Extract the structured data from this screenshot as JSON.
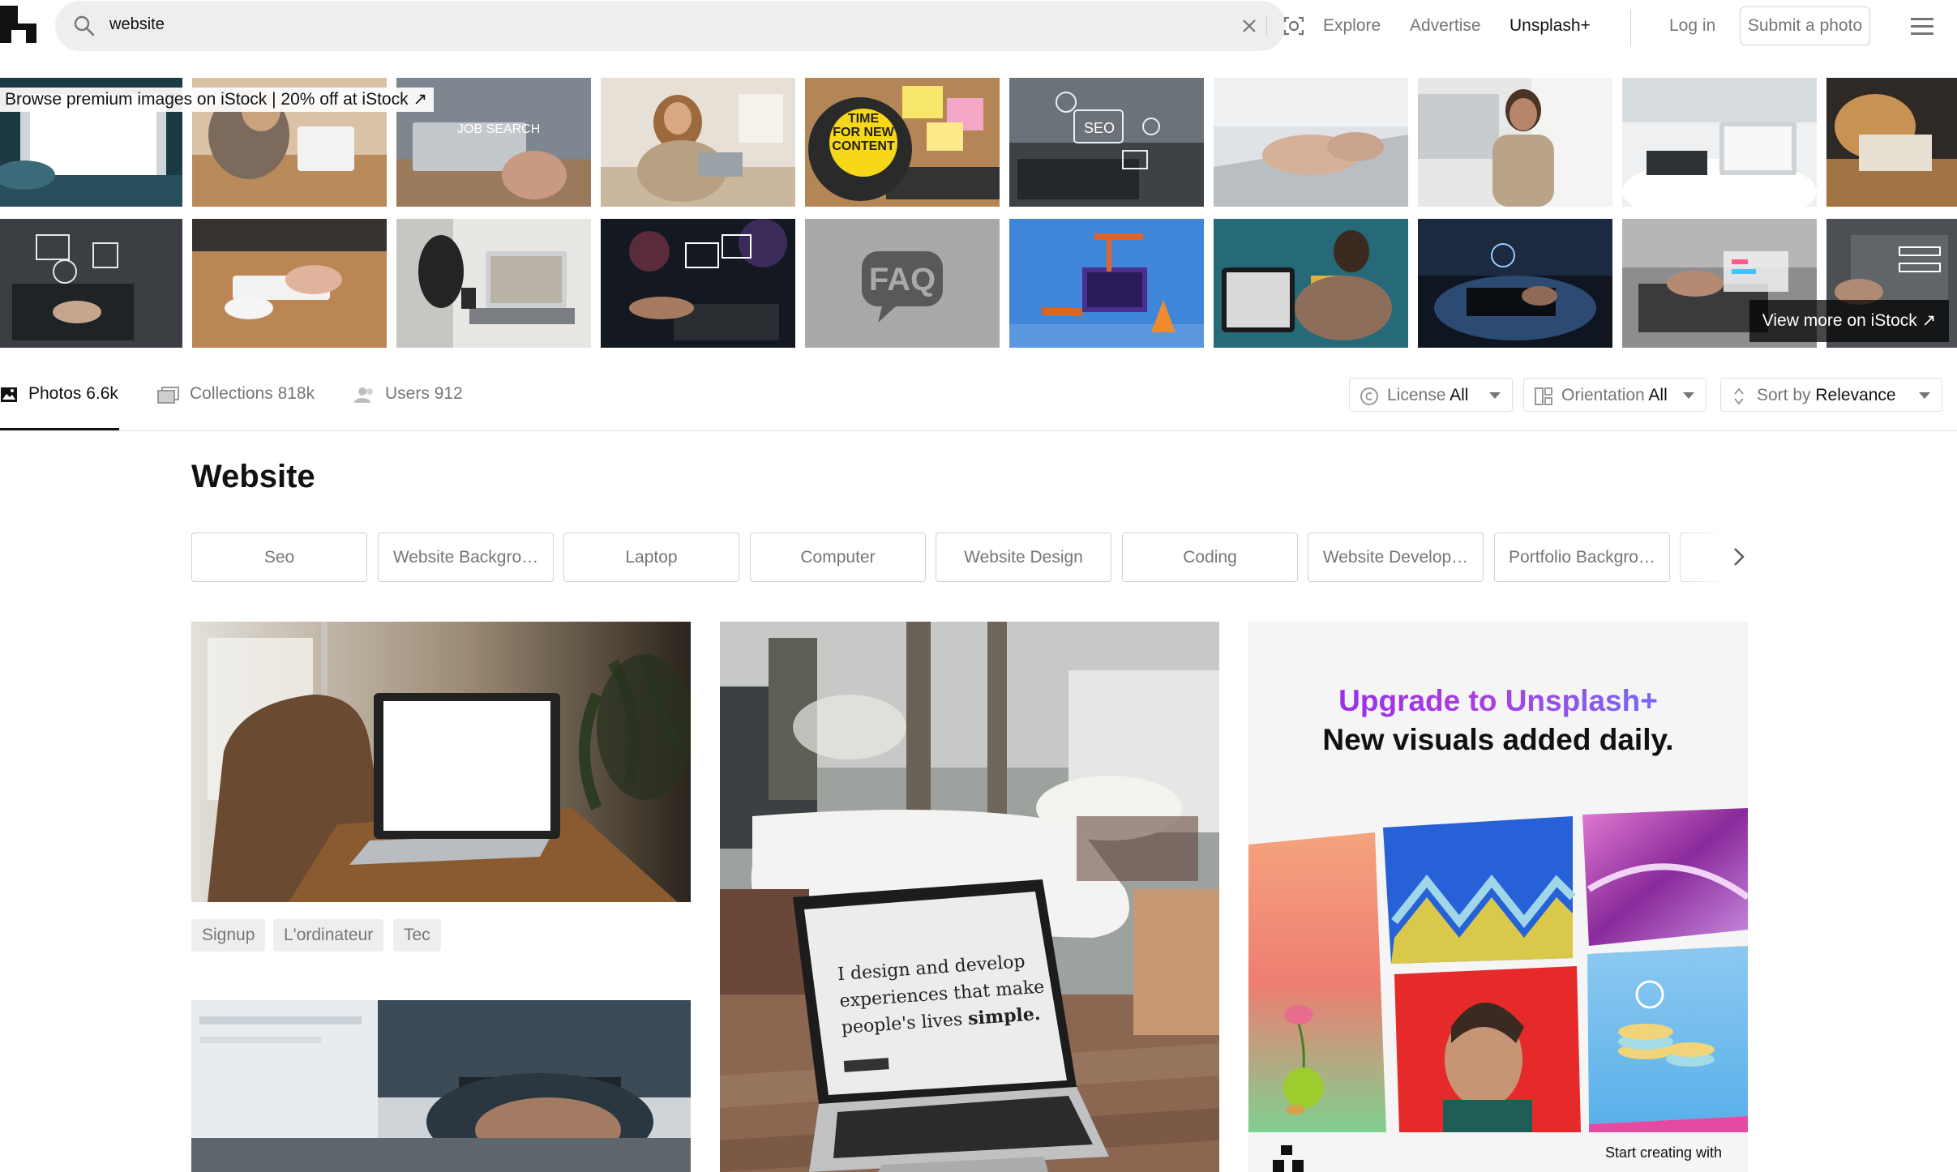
{
  "header": {
    "search_value": "website",
    "nav": {
      "explore": "Explore",
      "advertise": "Advertise",
      "plus": "Unsplash+",
      "login": "Log in",
      "submit": "Submit a photo"
    }
  },
  "istock": {
    "banner": "Browse premium images on iStock | 20% off at iStock ↗",
    "view_more": "View more on iStock ↗",
    "thumb_text": {
      "job": "JOB SEARCH",
      "time": "TIME\nFOR NEW\nCONTENT",
      "seo": "SEO",
      "faq": "FAQ"
    }
  },
  "tabs": [
    {
      "label": "Photos",
      "count": "6.6k",
      "active": true
    },
    {
      "label": "Collections",
      "count": "818k",
      "active": false
    },
    {
      "label": "Users",
      "count": "912",
      "active": false
    }
  ],
  "filters": {
    "license": {
      "label": "License",
      "value": "All"
    },
    "orientation": {
      "label": "Orientation",
      "value": "All"
    },
    "sort": {
      "label": "Sort by",
      "value": "Relevance"
    }
  },
  "page_title": "Website",
  "chips": [
    "Seo",
    "Website Backgro…",
    "Laptop",
    "Computer",
    "Website Design",
    "Coding",
    "Website Develop…",
    "Portfolio Backgro…"
  ],
  "photos": {
    "tags": [
      "Signup",
      "L'ordinateur",
      "Tec"
    ],
    "screen_text": {
      "line1": "I design and develop",
      "line2": "experiences that make",
      "line3": "people's lives",
      "bold": "simple."
    }
  },
  "promo": {
    "heading_line1": "Upgrade to Unsplash+",
    "heading_line2": "New visuals added daily.",
    "footer_text": "Start creating with"
  },
  "colors": {
    "text_primary": "#111111",
    "text_secondary": "#767676",
    "border": "#d1d1d1",
    "surface": "#eeeeee"
  }
}
